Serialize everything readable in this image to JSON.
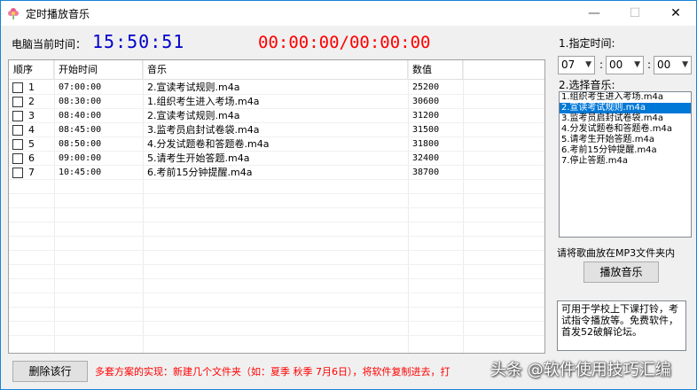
{
  "window": {
    "title": "定时播放音乐",
    "min_glyph": "—",
    "max_glyph": "☐",
    "close_glyph": "✕"
  },
  "clock": {
    "label": "电脑当前时间：",
    "time": "15:50:51",
    "countdown": "00:00:00/00:00:00"
  },
  "table": {
    "headers": [
      "顺序",
      "开始时间",
      "音乐",
      "数值",
      ""
    ],
    "rows": [
      {
        "n": "1",
        "time": "07:00:00",
        "music": "2.宣读考试规则.m4a",
        "value": "25200"
      },
      {
        "n": "2",
        "time": "08:30:00",
        "music": "1.组织考生进入考场.m4a",
        "value": "30600"
      },
      {
        "n": "3",
        "time": "08:40:00",
        "music": "2.宣读考试规则.m4a",
        "value": "31200"
      },
      {
        "n": "4",
        "time": "08:45:00",
        "music": "3.监考员启封试卷袋.m4a",
        "value": "31500"
      },
      {
        "n": "5",
        "time": "08:50:00",
        "music": "4.分发试题卷和答题卷.m4a",
        "value": "31800"
      },
      {
        "n": "6",
        "time": "09:00:00",
        "music": "5.请考生开始答题.m4a",
        "value": "32400"
      },
      {
        "n": "7",
        "time": "10:45:00",
        "music": "6.考前15分钟提醒.m4a",
        "value": "38700"
      }
    ]
  },
  "right": {
    "set_time_label": "1.指定时间:",
    "hour": "07",
    "minute": "00",
    "second": "00",
    "colon": ":",
    "choose_label": "2.选择音乐:",
    "music_list": [
      "1.组织考生进入考场.m4a",
      "2.宣读考试规则.m4a",
      "3.监考员启封试卷袋.m4a",
      "4.分发试题卷和答题卷.m4a",
      "5.请考生开始答题.m4a",
      "6.考前15分钟提醒.m4a",
      "7.停止答题.m4a"
    ],
    "selected_index": 1,
    "hint": "请将歌曲放在MP3文件夹内",
    "play_label": "播放音乐",
    "notes": "可用于学校上下课打铃，考试指令播放等。免费软件，首发52破解论坛。"
  },
  "bottom": {
    "delete_label": "删除该行",
    "footer": "多套方案的实现：新建几个文件夹（如：夏季 秋季 7月6日），将软件复制进去，打",
    "watermark": "头条 @软件使用技巧汇编"
  },
  "colors": {
    "clock": "#0000cc",
    "countdown": "#ff0000",
    "selection": "#0078d7",
    "footer_text": "#ff0000"
  },
  "icons": {
    "app": "flower-icon",
    "dropdown": "chevron-down-icon"
  }
}
